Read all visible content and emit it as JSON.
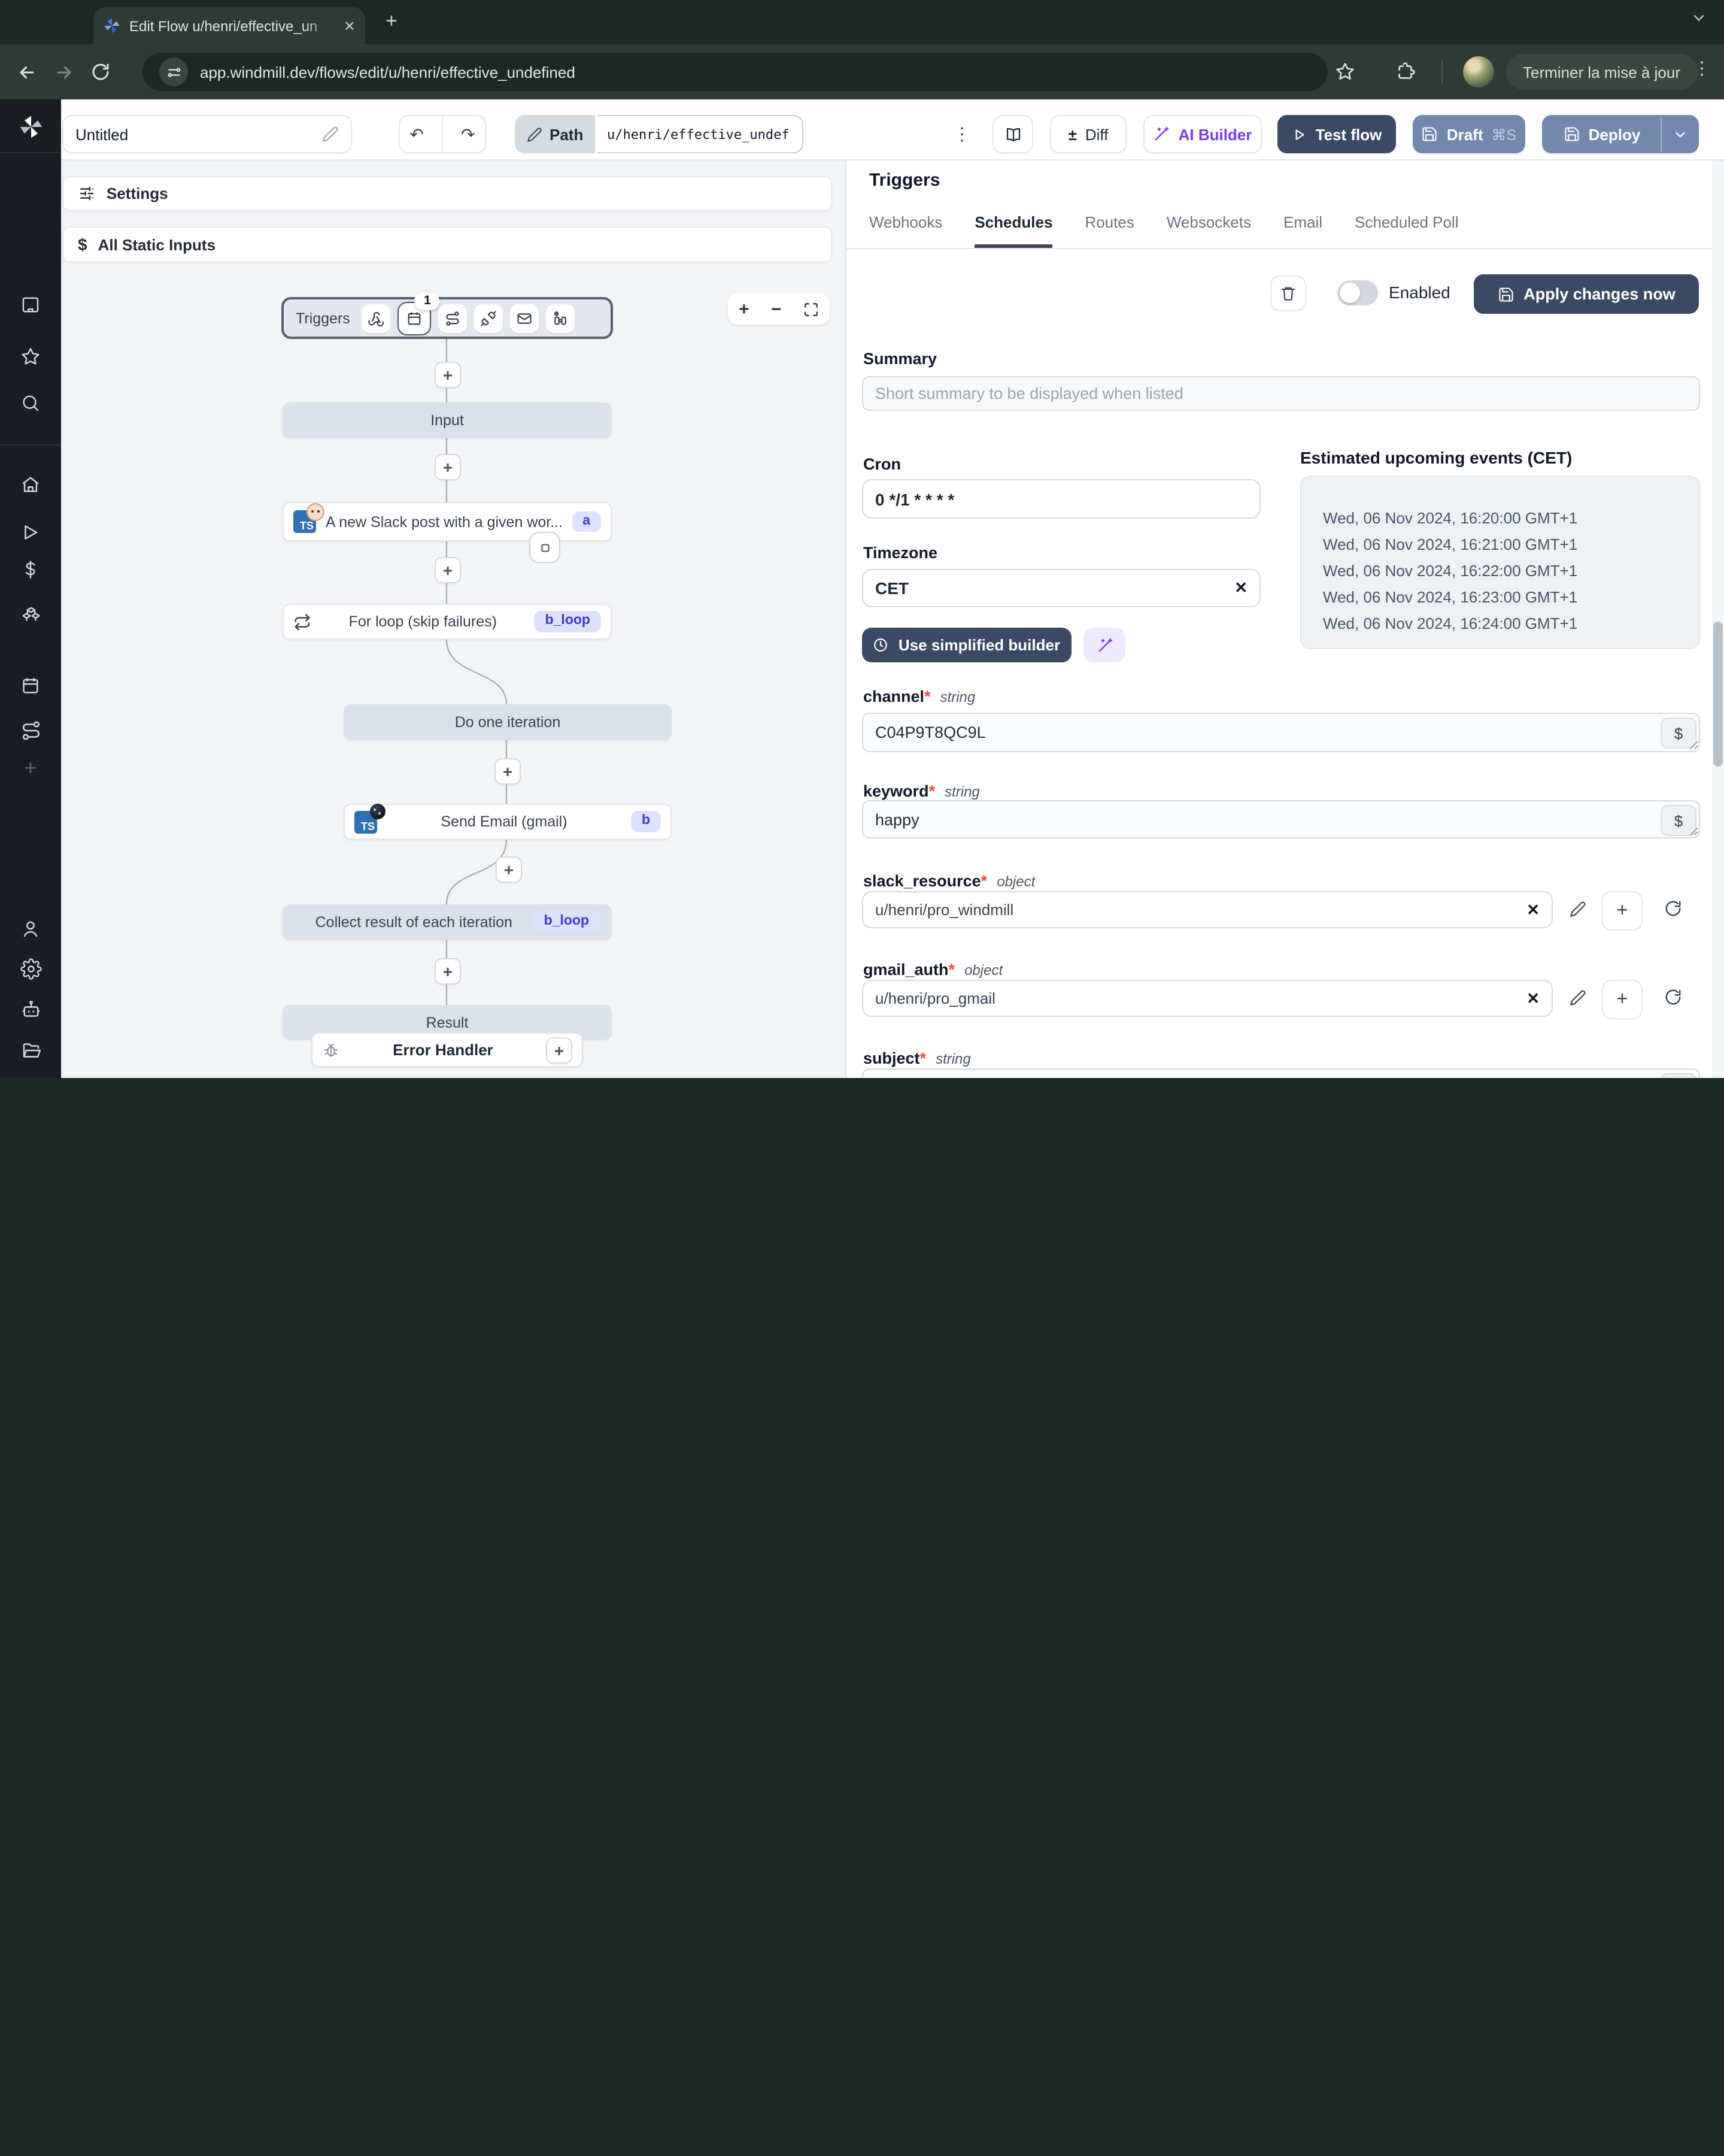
{
  "browser": {
    "tab_title": "Edit Flow u/henri/effective_un",
    "url": "app.windmill.dev/flows/edit/u/henri/effective_undefined",
    "update_button_label": "Terminer la mise à jour"
  },
  "header": {
    "flow_name": "Untitled",
    "path_label": "Path",
    "path_value": "u/henri/effective_undef",
    "diff_label": "Diff",
    "ai_builder_label": "AI Builder",
    "test_flow_label": "Test flow",
    "draft_label": "Draft",
    "draft_shortcut": "⌘S",
    "deploy_label": "Deploy"
  },
  "left_panel": {
    "settings_label": "Settings",
    "all_static_inputs_label": "All Static Inputs"
  },
  "flow": {
    "triggers_label": "Triggers",
    "schedule_count_badge": "1",
    "nodes": {
      "input": "Input",
      "slack_step": "A new Slack post with a given wor...",
      "slack_step_id": "a",
      "for_loop": "For loop (skip failures)",
      "for_loop_id": "b_loop",
      "do_one_iteration": "Do one iteration",
      "send_email": "Send Email (gmail)",
      "send_email_id": "b",
      "collect_result": "Collect result of each iteration",
      "collect_result_id": "b_loop",
      "result": "Result",
      "error_handler": "Error Handler"
    }
  },
  "panel": {
    "title": "Triggers",
    "tabs": [
      "Webhooks",
      "Schedules",
      "Routes",
      "Websockets",
      "Email",
      "Scheduled Poll"
    ],
    "active_tab": "Schedules",
    "enabled_label": "Enabled",
    "apply_button_label": "Apply changes now",
    "summary_label": "Summary",
    "summary_placeholder": "Short summary to be displayed when listed",
    "cron_label": "Cron",
    "cron_value": "0 */1 * * * *",
    "timezone_label": "Timezone",
    "timezone_value": "CET",
    "use_simplified_builder_label": "Use simplified builder",
    "events_title": "Estimated upcoming events (CET)",
    "events": [
      "Wed, 06 Nov 2024, 16:20:00 GMT+1",
      "Wed, 06 Nov 2024, 16:21:00 GMT+1",
      "Wed, 06 Nov 2024, 16:22:00 GMT+1",
      "Wed, 06 Nov 2024, 16:23:00 GMT+1",
      "Wed, 06 Nov 2024, 16:24:00 GMT+1"
    ],
    "required_marker": "*",
    "dollar_button_label": "$",
    "fields": [
      {
        "label": "channel",
        "type": "string",
        "value": "C04P9T8QC9L"
      },
      {
        "label": "keyword",
        "type": "string",
        "value": "happy"
      },
      {
        "label": "slack_resource",
        "type": "object",
        "value": "u/henri/pro_windmill"
      },
      {
        "label": "gmail_auth",
        "type": "object",
        "value": "u/henri/pro_gmail"
      },
      {
        "label": "subject",
        "type": "string",
        "value": ""
      }
    ]
  },
  "colors": {
    "navy_button": "#3C4964",
    "slate_button": "#7289AD",
    "badge_bg": "#DEE1FC",
    "badge_text": "#4338CA",
    "purple_accent": "#7C3AED",
    "canvas_bg": "#F2F4F6",
    "chrome_dark": "#1D2723"
  }
}
